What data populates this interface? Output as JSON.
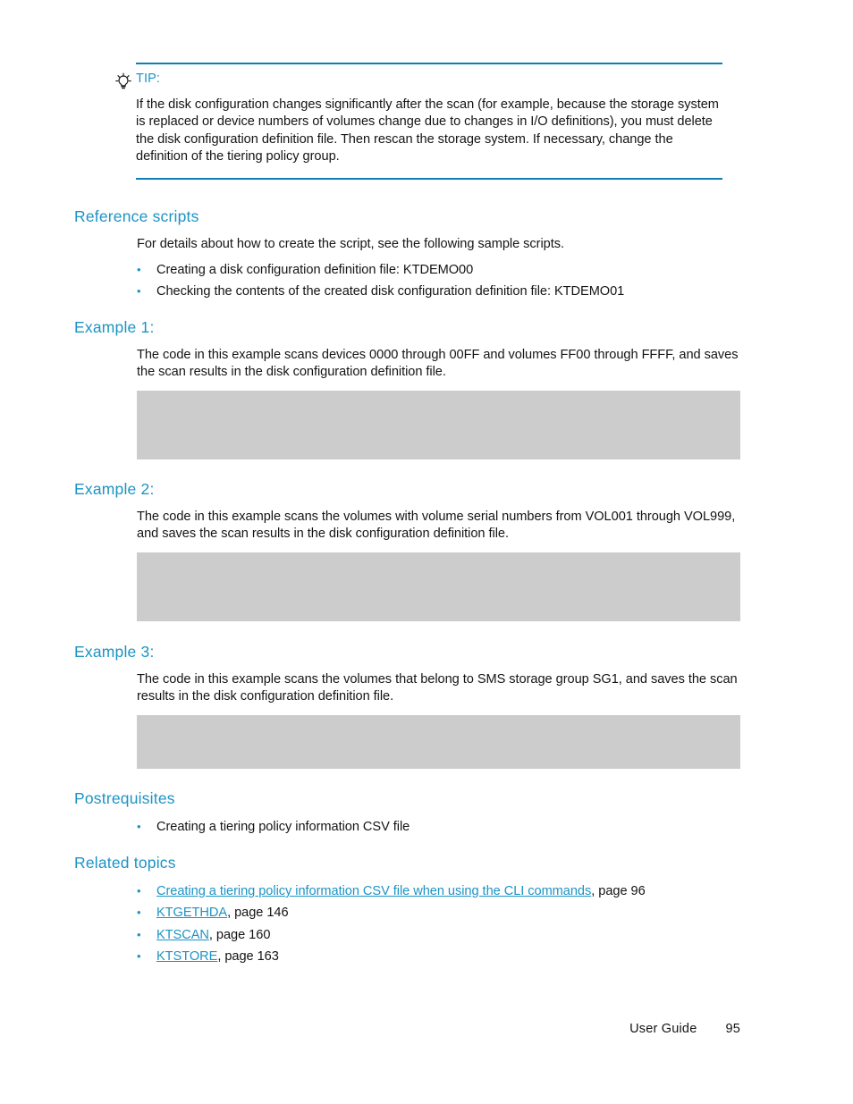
{
  "tip": {
    "icon": "lightbulb-icon",
    "label": "TIP:",
    "body": "If the disk configuration changes significantly after the scan (for example, because the storage system is replaced or device numbers of volumes change due to changes in I/O definitions), you must delete the disk configuration definition file. Then rescan the storage system. If necessary, change the definition of the tiering policy group."
  },
  "sections": {
    "reference_scripts": {
      "heading": "Reference scripts",
      "intro": "For details about how to create the script, see the following sample scripts.",
      "bullets": [
        "Creating a disk configuration definition file: KTDEMO00",
        "Checking the contents of the created disk configuration definition file: KTDEMO01"
      ]
    },
    "example1": {
      "heading": "Example 1:",
      "body": "The code in this example scans devices 0000 through 00FF and volumes FF00 through FFFF, and saves the scan results in the disk configuration definition file.",
      "code": ""
    },
    "example2": {
      "heading": "Example 2:",
      "body": "The code in this example scans the volumes with volume serial numbers from VOL001 through VOL999, and saves the scan results in the disk configuration definition file.",
      "code": ""
    },
    "example3": {
      "heading": "Example 3:",
      "body": "The code in this example scans the volumes that belong to SMS storage group SG1, and saves the scan results in the disk configuration definition file.",
      "code": ""
    },
    "postrequisites": {
      "heading": "Postrequisites",
      "bullets": [
        "Creating a tiering policy information CSV file"
      ]
    },
    "related_topics": {
      "heading": "Related topics",
      "links": [
        {
          "text": "Creating a tiering policy information CSV file when using the CLI commands",
          "suffix": ", page 96"
        },
        {
          "text": "KTGETHDA",
          "suffix": ", page 146"
        },
        {
          "text": "KTSCAN",
          "suffix": ", page 160"
        },
        {
          "text": "KTSTORE",
          "suffix": ", page 163"
        }
      ]
    }
  },
  "footer": {
    "label": "User Guide",
    "page": "95"
  },
  "colors": {
    "accent_blue": "#1c93c4",
    "rule_blue": "#0e80b5",
    "code_gray": "#cccccc",
    "body_text": "#141414"
  }
}
